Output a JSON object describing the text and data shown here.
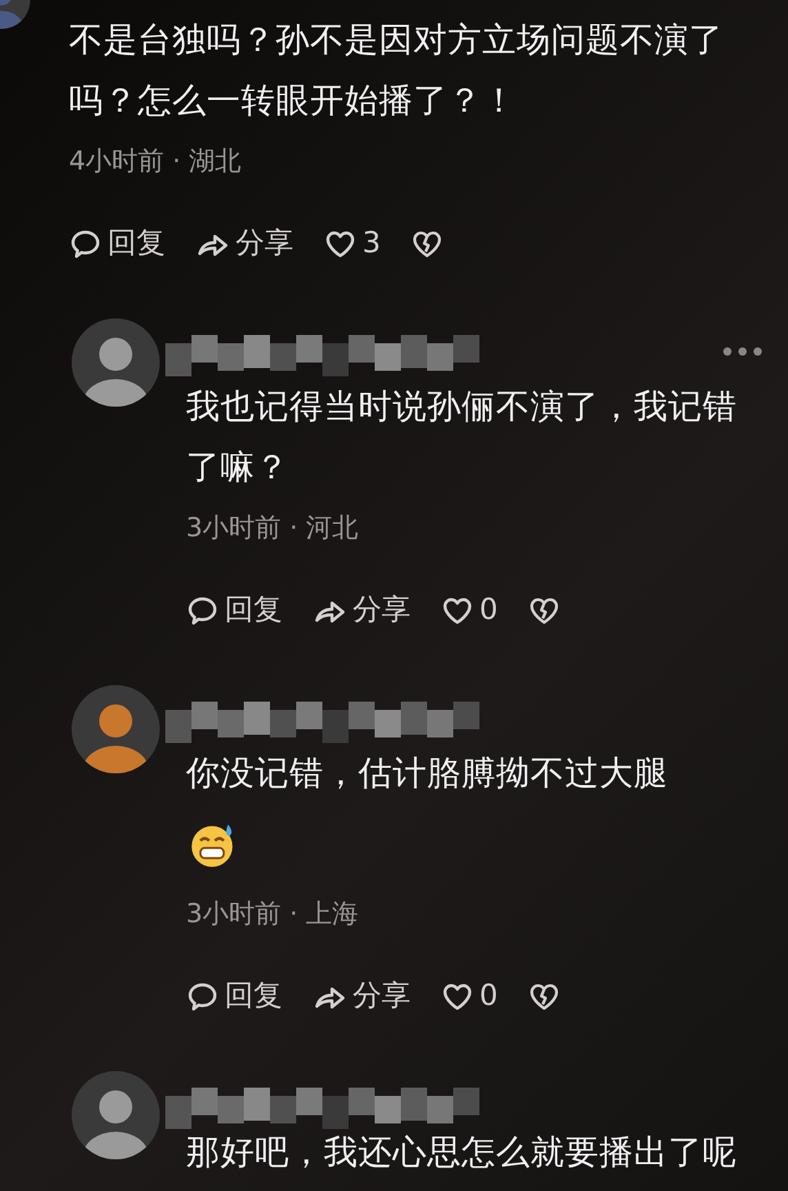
{
  "comments": [
    {
      "reply": false,
      "color": "#4a5a86",
      "text": "不是台独吗？孙不是因对方立场问题不演了吗？怎么一转眼开始播了？！",
      "emoji": false,
      "meta": "4小时前 · 湖北",
      "reply_label": "回复",
      "share_label": "分享",
      "likes": "3",
      "liked": false,
      "more": false
    },
    {
      "reply": true,
      "color": "#9a9a9a",
      "text": "我也记得当时说孙俪不演了，我记错了嘛？",
      "emoji": false,
      "meta": "3小时前 · 河北",
      "reply_label": "回复",
      "share_label": "分享",
      "likes": "0",
      "liked": false,
      "more": true
    },
    {
      "reply": true,
      "color": "#c9772c",
      "text": "你没记错，估计胳膊拗不过大腿",
      "emoji": true,
      "meta": "3小时前 · 上海",
      "reply_label": "回复",
      "share_label": "分享",
      "likes": "0",
      "liked": false,
      "more": false
    },
    {
      "reply": true,
      "color": "#9a9a9a",
      "text": "那好吧，我还心思怎么就要播出了呢",
      "emoji": false,
      "more": false
    }
  ]
}
